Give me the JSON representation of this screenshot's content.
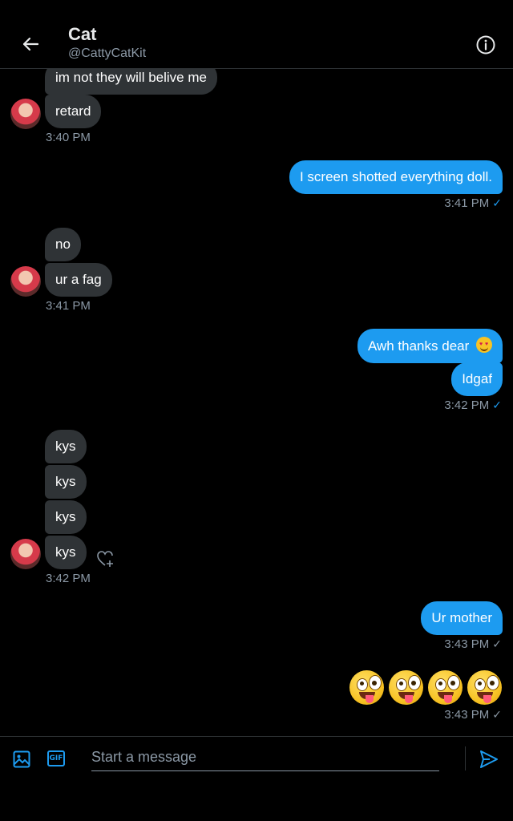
{
  "header": {
    "name": "Cat",
    "handle": "@CattyCatKit"
  },
  "messages": [
    {
      "dir": "in",
      "text": "im not they will belive me"
    },
    {
      "dir": "in",
      "text": "retard"
    },
    {
      "dir": "in",
      "time": "3:40 PM"
    },
    {
      "dir": "out",
      "text": "I screen shotted everything doll."
    },
    {
      "dir": "out",
      "time": "3:41 PM"
    },
    {
      "dir": "in",
      "text": "no"
    },
    {
      "dir": "in",
      "text": "ur a fag"
    },
    {
      "dir": "in",
      "time": "3:41 PM"
    },
    {
      "dir": "out",
      "text": "Awh thanks dear"
    },
    {
      "dir": "out",
      "text": "Idgaf"
    },
    {
      "dir": "out",
      "time": "3:42 PM"
    },
    {
      "dir": "in",
      "text": "kys"
    },
    {
      "dir": "in",
      "text": "kys"
    },
    {
      "dir": "in",
      "text": "kys"
    },
    {
      "dir": "in",
      "text": "kys"
    },
    {
      "dir": "in",
      "time": "3:42 PM"
    },
    {
      "dir": "out",
      "text": "Ur mother"
    },
    {
      "dir": "out",
      "time": "3:43 PM"
    },
    {
      "dir": "out",
      "emoji": "zany-face",
      "count": 4
    },
    {
      "dir": "out",
      "time": "3:43 PM"
    }
  ],
  "composer": {
    "placeholder": "Start a message",
    "gif_label": "GIF"
  },
  "icons": {
    "back": "arrow-left-icon",
    "info": "info-icon",
    "media": "image-icon",
    "gif": "gif-icon",
    "send": "send-icon",
    "react": "heart-plus-icon",
    "seen": "checkmark-icon"
  },
  "colors": {
    "background": "#000000",
    "incoming_bubble": "#2f3336",
    "outgoing_bubble": "#1d9bf0",
    "accent": "#1d9bf0",
    "secondary_text": "#8b98a5"
  }
}
